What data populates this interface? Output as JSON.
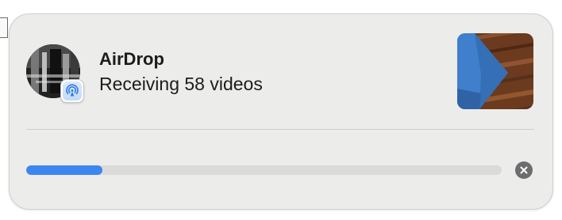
{
  "notification": {
    "title": "AirDrop",
    "subtitle": "Receiving 58 videos",
    "progress_fraction": 0.16
  },
  "icons": {
    "badge": "airdrop-icon",
    "cancel": "close-icon",
    "avatar": "sender-avatar",
    "thumbnail": "video-thumbnail"
  },
  "colors": {
    "progress": "#3d86f2",
    "track": "#dadada",
    "panel": "#ececea",
    "cancel": "#6d6d6d"
  }
}
